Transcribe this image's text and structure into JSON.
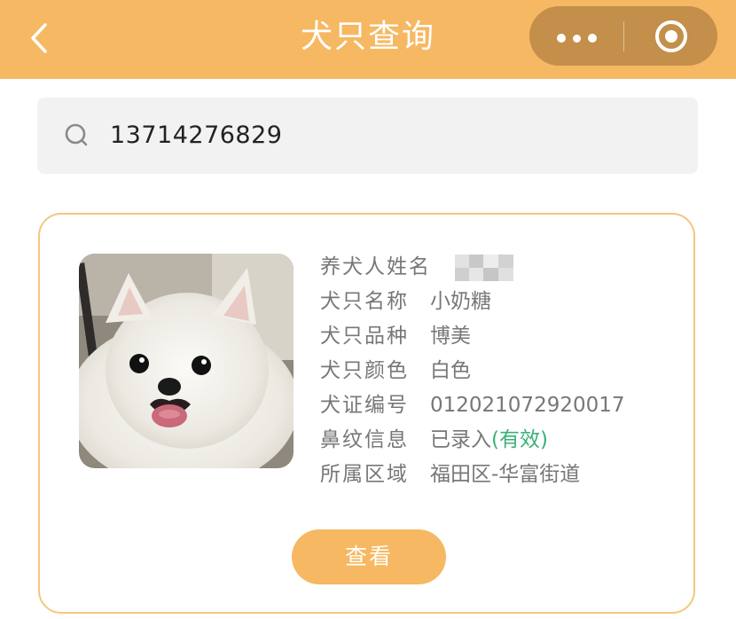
{
  "header": {
    "title": "犬只查询"
  },
  "search": {
    "value": "13714276829"
  },
  "card": {
    "fields": [
      {
        "label": "养犬人姓名",
        "value": ""
      },
      {
        "label": "犬只名称",
        "value": "小奶糖"
      },
      {
        "label": "犬只品种",
        "value": "博美"
      },
      {
        "label": "犬只颜色",
        "value": "白色"
      },
      {
        "label": "犬证编号",
        "value": "012021072920017"
      },
      {
        "label": "鼻纹信息",
        "value": "已录入",
        "status": "(有效)"
      },
      {
        "label": "所属区域",
        "value": "福田区-华富街道"
      }
    ],
    "view_button": "查看"
  },
  "colors": {
    "header": "#f6b862",
    "capsule": "#c38f4a",
    "card_border": "#f3c77f",
    "valid": "#3bb07a"
  },
  "icons": [
    "chevron-left-icon",
    "more-dots-icon",
    "target-icon",
    "search-icon"
  ]
}
